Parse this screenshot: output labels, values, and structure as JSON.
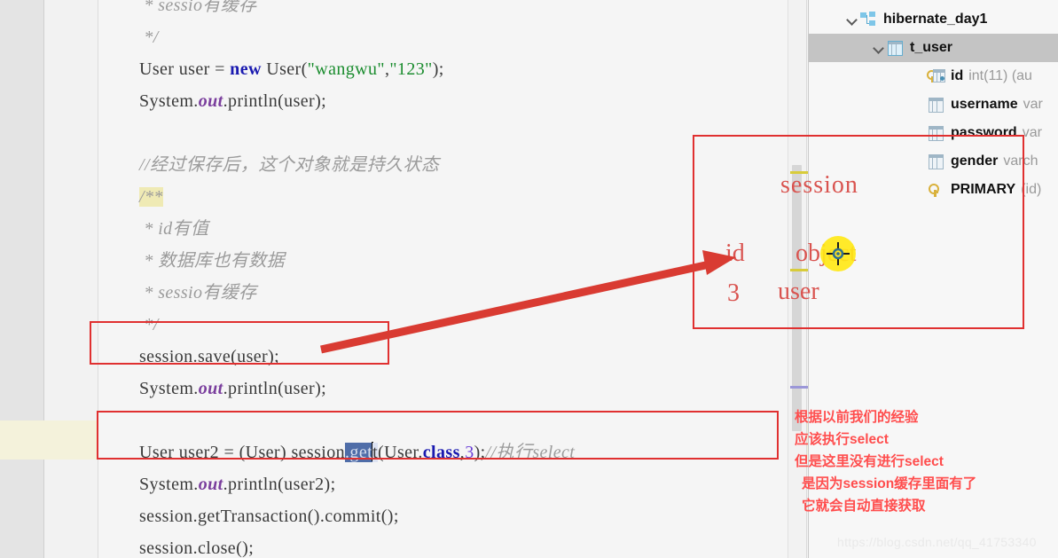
{
  "editor": {
    "lines": [
      {
        "indent": 1,
        "parts": [
          {
            "t": " * sessio有缓存",
            "c": "cmt"
          }
        ],
        "clipped_top": true
      },
      {
        "indent": 1,
        "parts": [
          {
            "t": " */",
            "c": "cmt"
          }
        ]
      },
      {
        "indent": 1,
        "parts": [
          {
            "t": "User user = ",
            "c": ""
          },
          {
            "t": "new",
            "c": "kw"
          },
          {
            "t": " User(",
            "c": ""
          },
          {
            "t": "\"wangwu\"",
            "c": "str"
          },
          {
            "t": ",",
            "c": ""
          },
          {
            "t": "\"123\"",
            "c": "str"
          },
          {
            "t": ");",
            "c": ""
          }
        ]
      },
      {
        "indent": 1,
        "parts": [
          {
            "t": "System.",
            "c": ""
          },
          {
            "t": "out",
            "c": "fld"
          },
          {
            "t": ".println(user);",
            "c": ""
          }
        ]
      },
      {
        "indent": 1,
        "parts": []
      },
      {
        "indent": 1,
        "parts": [
          {
            "t": "//经过保存后，这个对象就是持久状态",
            "c": "cmt"
          }
        ]
      },
      {
        "indent": 1,
        "parts": [
          {
            "t": "/**",
            "c": "cmt tokhl"
          }
        ]
      },
      {
        "indent": 1,
        "parts": [
          {
            "t": " * id有值",
            "c": "cmt"
          }
        ]
      },
      {
        "indent": 1,
        "parts": [
          {
            "t": " * 数据库也有数据",
            "c": "cmt"
          }
        ]
      },
      {
        "indent": 1,
        "parts": [
          {
            "t": " * sessio有缓存",
            "c": "cmt"
          }
        ]
      },
      {
        "indent": 1,
        "parts": [
          {
            "t": " */",
            "c": "cmt"
          }
        ]
      },
      {
        "indent": 1,
        "parts": [
          {
            "t": "session.save(user);",
            "c": ""
          }
        ]
      },
      {
        "indent": 1,
        "parts": [
          {
            "t": "System.",
            "c": ""
          },
          {
            "t": "out",
            "c": "fld"
          },
          {
            "t": ".println(user);",
            "c": ""
          }
        ]
      },
      {
        "indent": 1,
        "parts": []
      },
      {
        "indent": 1,
        "parts": [
          {
            "t": "User user2 = (User) session",
            "c": ""
          },
          {
            "t": ".get",
            "c": "sel"
          },
          {
            "t": "|",
            "c": "caret"
          },
          {
            "t": "t",
            "c": "selafter"
          },
          {
            "t": "(User.",
            "c": ""
          },
          {
            "t": "class",
            "c": "cls"
          },
          {
            "t": ",",
            "c": ""
          },
          {
            "t": "3",
            "c": "num"
          },
          {
            "t": ");",
            "c": ""
          },
          {
            "t": "//执行select",
            "c": "cmt"
          }
        ]
      },
      {
        "indent": 1,
        "parts": [
          {
            "t": "System.",
            "c": ""
          },
          {
            "t": "out",
            "c": "fld"
          },
          {
            "t": ".println(user2);",
            "c": ""
          }
        ]
      },
      {
        "indent": 1,
        "parts": [
          {
            "t": "session.getTransaction().commit();",
            "c": ""
          }
        ]
      },
      {
        "indent": 1,
        "parts": [
          {
            "t": "session.close();",
            "c": ""
          }
        ]
      }
    ]
  },
  "db_tree": {
    "rows": [
      {
        "indent": 0,
        "icon": "schema-icon",
        "name": "hibernate_day1",
        "type": "",
        "chevron": true,
        "selected": false
      },
      {
        "indent": 1,
        "icon": "table-icon",
        "name": "t_user",
        "type": "",
        "chevron": true,
        "selected": true
      },
      {
        "indent": 2,
        "icon": "primary-key-column-icon",
        "name": "id",
        "type": "int(11) (au",
        "chevron": false,
        "selected": false
      },
      {
        "indent": 2,
        "icon": "column-icon",
        "name": "username",
        "type": "var",
        "chevron": false,
        "selected": false
      },
      {
        "indent": 2,
        "icon": "column-icon",
        "name": "password",
        "type": "var",
        "chevron": false,
        "selected": false
      },
      {
        "indent": 2,
        "icon": "column-icon",
        "name": "gender",
        "type": "varch",
        "chevron": false,
        "selected": false
      },
      {
        "indent": 2,
        "icon": "key-icon",
        "name": "PRIMARY",
        "type": "(id)",
        "chevron": false,
        "selected": false
      }
    ]
  },
  "annotations": {
    "diagram": {
      "title": "session",
      "col_key": "id",
      "col_value": "object",
      "row_key": "3",
      "row_value": "user"
    },
    "note_lines": [
      "根据以前我们的经验",
      "应该执行select",
      "但是这里没有进行select",
      "是因为session缓存里面有了",
      "它就会自动直接获取"
    ],
    "colors": {
      "box_border": "#e03030",
      "arrow": "#d93b32",
      "note_text": "#ff4d4d",
      "diagram_text": "#d9534f",
      "cursor_highlight": "#ffe817",
      "selection": "#4f6da8",
      "current_line": "#f4f2db"
    }
  },
  "watermark": {
    "text": "https://blog.csdn.net/qq_41753340"
  }
}
